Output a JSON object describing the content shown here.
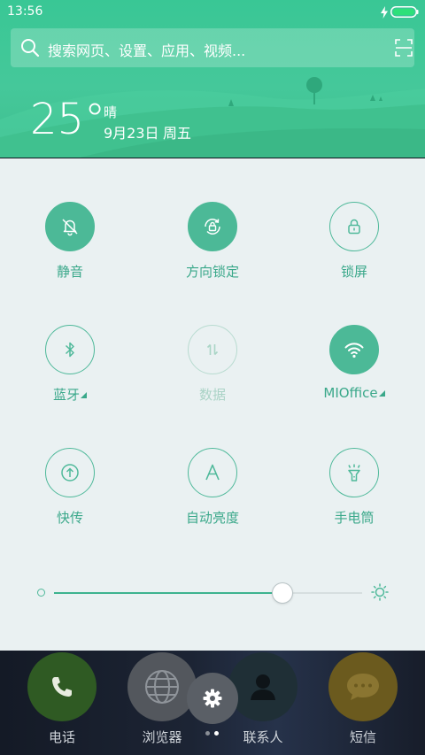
{
  "status_bar": {
    "time": "13:56",
    "battery": "charging-full"
  },
  "search": {
    "placeholder": "搜索网页、设置、应用、视频..."
  },
  "weather": {
    "temperature": "25°",
    "condition": "晴",
    "date": "9月23日",
    "weekday": "周五"
  },
  "quick_settings": {
    "tiles": [
      {
        "label": "静音",
        "icon": "bell-off-icon",
        "state": "on"
      },
      {
        "label": "方向锁定",
        "icon": "rotation-lock-icon",
        "state": "on"
      },
      {
        "label": "锁屏",
        "icon": "lock-icon",
        "state": "off"
      },
      {
        "label": "蓝牙",
        "icon": "bluetooth-icon",
        "state": "off",
        "has_menu": true
      },
      {
        "label": "数据",
        "icon": "data-transfer-icon",
        "state": "disabled"
      },
      {
        "label": "MIOffice",
        "icon": "wifi-icon",
        "state": "on",
        "has_menu": true
      },
      {
        "label": "快传",
        "icon": "upload-icon",
        "state": "off"
      },
      {
        "label": "自动亮度",
        "icon": "auto-brightness-icon",
        "state": "off"
      },
      {
        "label": "手电筒",
        "icon": "flashlight-icon",
        "state": "off"
      }
    ],
    "brightness": 0.74
  },
  "dock": {
    "apps": [
      {
        "label": "电话",
        "icon": "phone-icon",
        "color": "#2f7d32"
      },
      {
        "label": "浏览器",
        "icon": "globe-icon",
        "color": "#5f656d"
      },
      {
        "label": "联系人",
        "icon": "person-icon",
        "color": "#23363e"
      },
      {
        "label": "短信",
        "icon": "message-icon",
        "color": "#b7902a"
      }
    ],
    "settings_icon": "gear-icon",
    "page_indicator": {
      "pages": 2,
      "current": 2
    }
  },
  "colors": {
    "accent": "#4cb997",
    "header": "#3fc292",
    "panel_bg": "#eaf1f2"
  }
}
